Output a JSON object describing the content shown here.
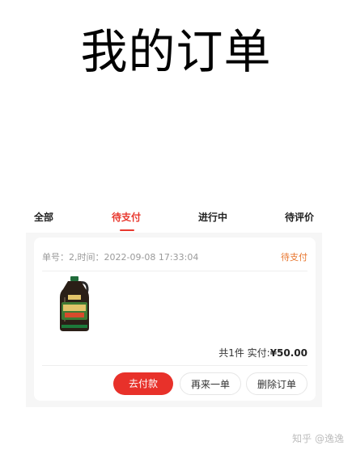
{
  "page_title": "我的订单",
  "tabs": [
    {
      "label": "全部",
      "active": false
    },
    {
      "label": "待支付",
      "active": true
    },
    {
      "label": "进行中",
      "active": false
    },
    {
      "label": "待评价",
      "active": false
    }
  ],
  "order": {
    "info": "单号：2,时间：2022-09-08 17:33:04",
    "status": "待支付",
    "product_image": "soy-sauce-bottle",
    "count_text": "共1件 实付:",
    "total": "¥50.00",
    "buttons": {
      "pay": "去付款",
      "reorder": "再来一单",
      "delete": "删除订单"
    }
  },
  "watermark": "知乎 @逸逸",
  "colors": {
    "accent": "#e8382e",
    "status": "#e8762e"
  }
}
